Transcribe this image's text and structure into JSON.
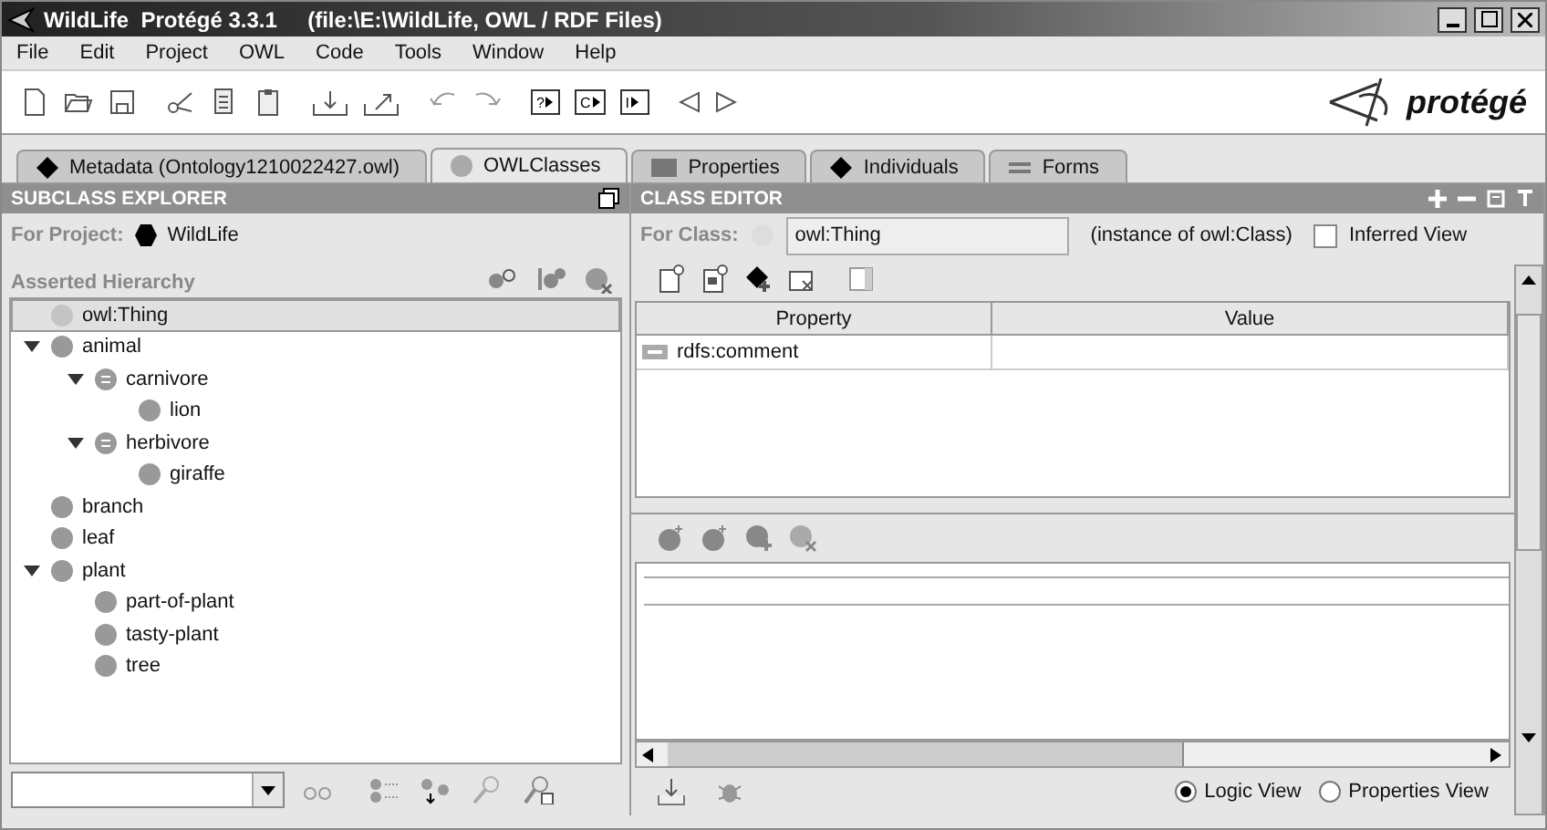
{
  "window": {
    "title": "WildLife  Protégé 3.3.1     (file:\\E:\\WildLife, OWL / RDF Files)"
  },
  "menu": [
    "File",
    "Edit",
    "Project",
    "OWL",
    "Code",
    "Tools",
    "Window",
    "Help"
  ],
  "toolbar": {
    "query_buttons": [
      "?",
      "C",
      "I"
    ],
    "logo": "protégé"
  },
  "tabs": [
    {
      "label": "Metadata (Ontology1210022427.owl)",
      "kind": "diamond",
      "selected": false
    },
    {
      "label": "OWLClasses",
      "kind": "circle",
      "selected": true
    },
    {
      "label": "Properties",
      "kind": "square",
      "selected": false
    },
    {
      "label": "Individuals",
      "kind": "diamond",
      "selected": false
    },
    {
      "label": "Forms",
      "kind": "lines",
      "selected": false
    }
  ],
  "subclass_explorer": {
    "title": "SUBCLASS EXPLORER",
    "project_label": "For Project:",
    "project": "WildLife",
    "hierarchy_label": "Asserted Hierarchy",
    "tree": [
      {
        "label": "owl:Thing",
        "kind": "root",
        "selected": true
      },
      {
        "label": "animal",
        "kind": "primitive",
        "selected": false,
        "expanded": true,
        "children": [
          {
            "label": "carnivore",
            "kind": "defined",
            "selected": false,
            "expanded": true,
            "children": [
              {
                "label": "lion",
                "kind": "primitive",
                "selected": false
              }
            ]
          },
          {
            "label": "herbivore",
            "kind": "defined",
            "selected": false,
            "expanded": true,
            "children": [
              {
                "label": "giraffe",
                "kind": "primitive",
                "selected": false
              }
            ]
          }
        ]
      },
      {
        "label": "branch",
        "kind": "primitive",
        "selected": false
      },
      {
        "label": "leaf",
        "kind": "primitive",
        "selected": false
      },
      {
        "label": "plant",
        "kind": "primitive",
        "selected": false,
        "expanded": true,
        "children": [
          {
            "label": "part-of-plant",
            "kind": "primitive",
            "selected": false
          },
          {
            "label": "tasty-plant",
            "kind": "primitive",
            "selected": false
          },
          {
            "label": "tree",
            "kind": "primitive",
            "selected": false
          }
        ]
      }
    ]
  },
  "class_editor": {
    "title": "CLASS EDITOR",
    "class_label": "For Class:",
    "class_value": "owl:Thing",
    "instance_of": "(instance of owl:Class)",
    "inferred_view": {
      "label": "Inferred View",
      "checked": false
    },
    "table": {
      "columns": [
        "Property",
        "Value"
      ],
      "rows": [
        {
          "property": "rdfs:comment"
        }
      ]
    },
    "views": [
      {
        "label": "Logic View",
        "selected": true
      },
      {
        "label": "Properties View",
        "selected": false
      }
    ]
  }
}
